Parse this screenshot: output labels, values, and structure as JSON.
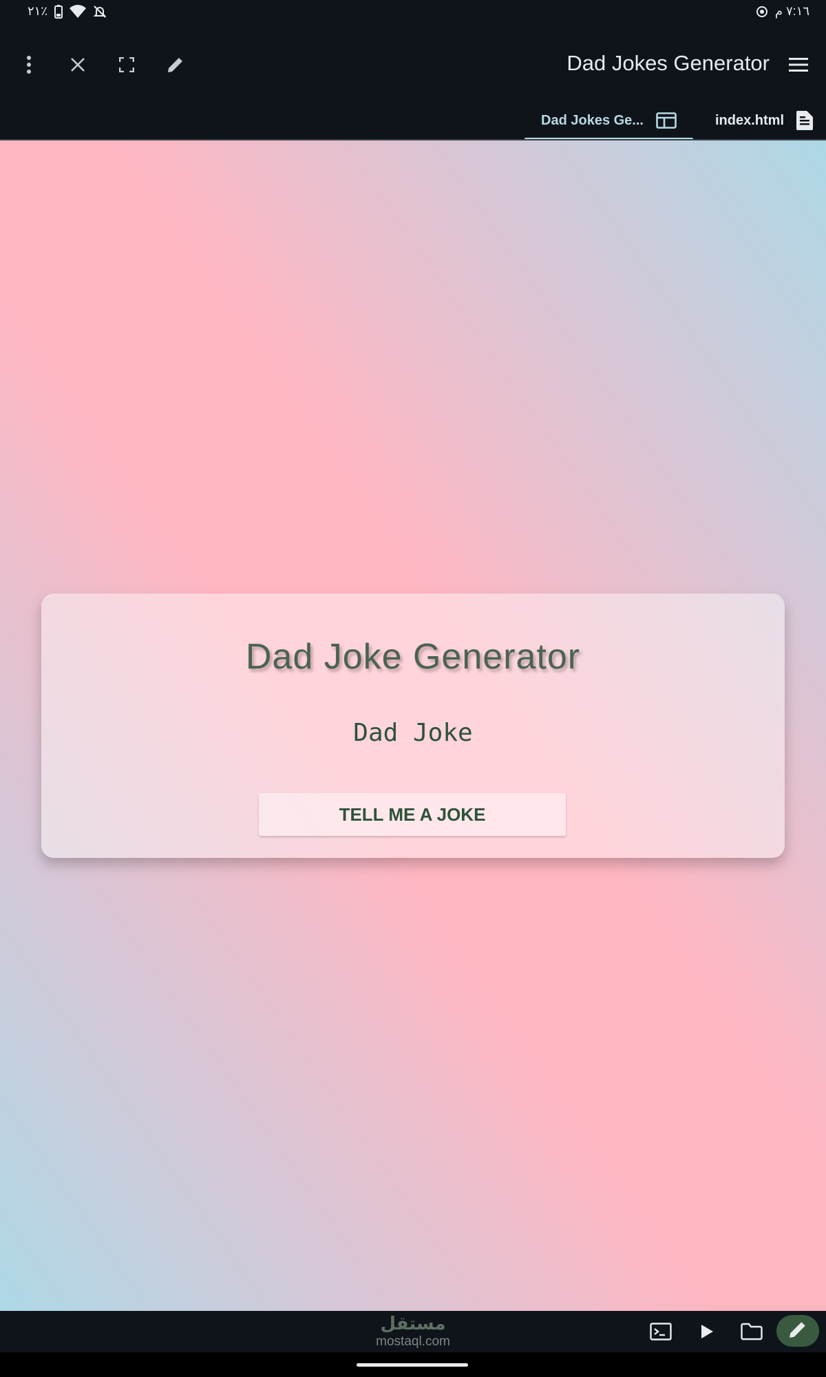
{
  "status_bar": {
    "time": "٧:١٦ م",
    "battery": "٢١٪",
    "icons": [
      "notifications-off-icon",
      "wifi-icon",
      "battery-icon",
      "screen-record-icon"
    ]
  },
  "app_bar": {
    "title": "Dad Jokes Generator",
    "tools": [
      "more-vert-icon",
      "close-icon",
      "fullscreen-icon",
      "edit-icon",
      "menu-icon"
    ],
    "tabs": [
      {
        "label": "Dad Jokes Ge...",
        "icon": "web-preview-icon",
        "active": true
      },
      {
        "label": "index.html",
        "icon": "document-icon",
        "active": false
      }
    ]
  },
  "page": {
    "background_colors": [
      "#add8e6",
      "#ffb6c1"
    ],
    "card": {
      "title": "Dad Joke Generator",
      "joke": "Dad Joke",
      "button_label": "TELL ME A JOKE"
    }
  },
  "bottom_bar": {
    "watermark_logo": "مستقل",
    "watermark_site": "mostaql.com",
    "icons": [
      "terminal-icon",
      "play-icon",
      "folder-icon",
      "edit-icon"
    ],
    "accent": "#3a5a40"
  }
}
